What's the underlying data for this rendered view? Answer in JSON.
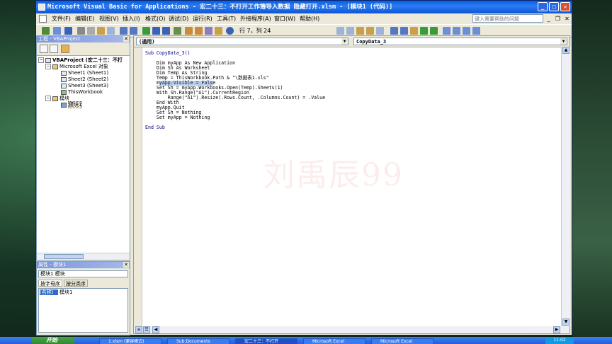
{
  "window": {
    "title": "Microsoft Visual Basic for Applications - 宏二十三：不打开工作簿导入数据 隐藏打开.xlsm - [模块1 (代码)]",
    "minimize": "_",
    "maximize": "□",
    "close": "✕"
  },
  "menu": {
    "items": [
      "文件(F)",
      "编辑(E)",
      "视图(V)",
      "插入(I)",
      "格式(O)",
      "调试(D)",
      "运行(R)",
      "工具(T)",
      "外接程序(A)",
      "窗口(W)",
      "帮助(H)"
    ],
    "help_placeholder": "键入需要帮助的问题"
  },
  "toolbar": {
    "cursor_position": "行 7，列 24"
  },
  "project": {
    "title": "工程 - VBAProject",
    "tree": [
      "VBAProject (宏二十三：不打",
      "Microsoft Excel 对象",
      "Sheet1 (Sheet1)",
      "Sheet2 (Sheet2)",
      "Sheet3 (Sheet3)",
      "ThisWorkbook",
      "模块",
      "模块1"
    ]
  },
  "properties": {
    "title": "属性 - 模块1",
    "selected_object": "模块1 模块",
    "tabs": [
      "按字母序",
      "按分类序"
    ],
    "prop_name": "(名称)",
    "prop_value": "模块1"
  },
  "code_window": {
    "object_combo": "(通用)",
    "proc_combo": "CopyData_3",
    "lines": [
      "Sub CopyData_3()",
      "",
      "    Dim myApp As New Application",
      "    Dim Sh As Worksheet",
      "    Dim Temp As String",
      "    Temp = ThisWorkbook.Path & \"\\数据表1.xls\"",
      "    myApp.Visible = False",
      "    Set Sh = myApp.Workbooks.Open(Temp).Sheets(1)",
      "    With Sh.Range(\"A1\").CurrentRegion",
      "        Range(\"A1\").Resize(.Rows.Count, .Columns.Count) = .Value",
      "    End With",
      "    myApp.Quit",
      "    Set Sh = Nothing",
      "    Set myApp = Nothing",
      "",
      "End Sub"
    ],
    "watermark": "刘禹辰99"
  },
  "taskbar": {
    "start": "开始",
    "tasks": [
      "1.xlsm (兼容模式)",
      "Sub:Documents",
      "宏二十三：不打开",
      "Microsoft Excel",
      "Microsoft Excel"
    ],
    "clock": "11:02"
  }
}
